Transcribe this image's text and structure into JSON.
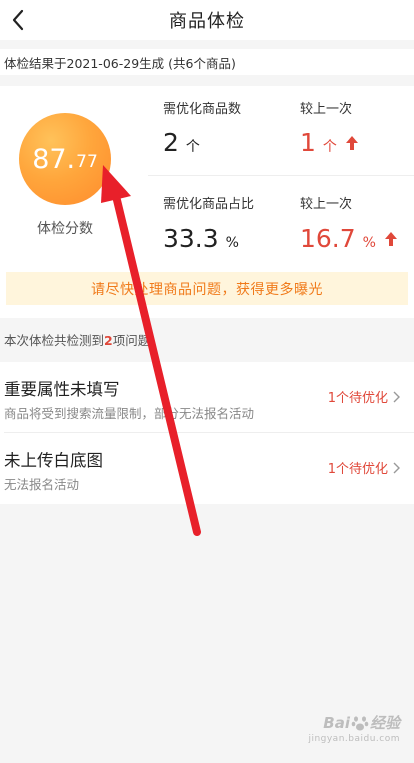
{
  "header": {
    "title": "商品体检",
    "back_icon": "chevron-left-icon"
  },
  "result_line": "体检结果于2021-06-29生成 (共6个商品)",
  "score": {
    "integer": "87.",
    "decimal": "77",
    "label": "体检分数",
    "gradient_colors": [
      "#ffc25a",
      "#ff8b2c"
    ]
  },
  "metrics": {
    "count": {
      "label": "需优化商品数",
      "value": "2",
      "unit": "个",
      "compare_label": "较上一次",
      "compare_value": "1",
      "compare_unit": "个",
      "trend_icon": "arrow-up-icon"
    },
    "ratio": {
      "label": "需优化商品占比",
      "value": "33.3",
      "unit": "%",
      "compare_label": "较上一次",
      "compare_value": "16.7",
      "compare_unit": "%",
      "trend_icon": "arrow-up-icon"
    }
  },
  "tip": "请尽快处理商品问题，获得更多曝光",
  "detect": {
    "prefix": "本次体检共检测到",
    "count": "2",
    "suffix": "项问题"
  },
  "issues": [
    {
      "title": "重要属性未填写",
      "desc": "商品将受到搜索流量限制，部分无法报名活动",
      "action": "1个待优化"
    },
    {
      "title": "未上传白底图",
      "desc": "无法报名活动",
      "action": "1个待优化"
    }
  ],
  "watermark": {
    "left": "Bai",
    "right": "经验",
    "sub": "jingyan.baidu.com"
  },
  "colors": {
    "accent_red": "#e0483a",
    "tip_bg": "#fff5dc",
    "tip_text": "#f07a1a",
    "annotation_arrow": "#e8202a"
  }
}
